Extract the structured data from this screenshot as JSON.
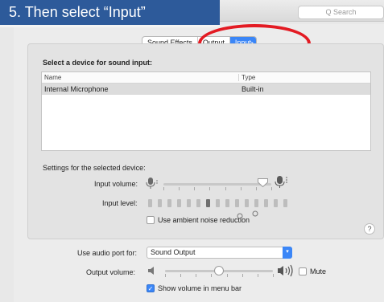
{
  "caption": "5. Then select “Input”",
  "search": {
    "placeholder": "Q Search"
  },
  "tabs": [
    {
      "label": "Sound Effects",
      "selected": false
    },
    {
      "label": "Output",
      "selected": false
    },
    {
      "label": "Input",
      "selected": true
    }
  ],
  "input_section": {
    "heading": "Select a device for sound input:",
    "columns": [
      "Name",
      "Type"
    ],
    "rows": [
      {
        "name": "Internal Microphone",
        "type": "Built-in",
        "selected": true
      }
    ],
    "settings_heading": "Settings for the selected device:",
    "input_volume_label": "Input volume:",
    "input_volume_level": 0.92,
    "input_level_label": "Input level:",
    "input_level_segments": 15,
    "ambient_noise_label": "Use ambient noise reduction",
    "ambient_noise_checked": false
  },
  "audio_port": {
    "label": "Use audio port for:",
    "value": "Sound Output"
  },
  "output": {
    "label": "Output volume:",
    "volume_level": 0.5,
    "mute_label": "Mute",
    "mute_checked": false,
    "menu_bar_label": "Show volume in menu bar",
    "menu_bar_checked": true
  },
  "icons": {
    "mic_low": "microphone-low-icon",
    "mic_high": "microphone-high-icon",
    "speaker_low": "speaker-low-icon",
    "speaker_high": "speaker-high-icon",
    "help": "help-icon"
  },
  "colors": {
    "caption_bg": "#2d5a9a",
    "accent": "#3b86f7",
    "highlight_ellipse": "#e31b23"
  }
}
